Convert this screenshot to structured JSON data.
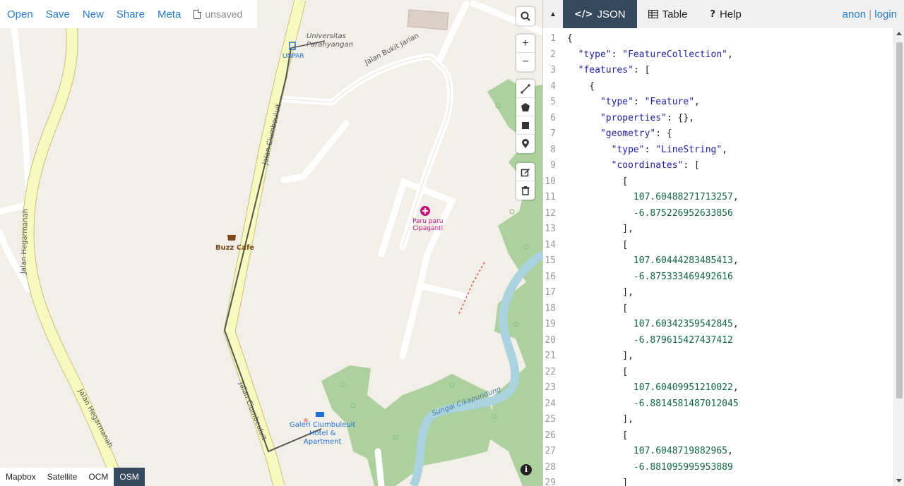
{
  "menu": {
    "items": [
      "Open",
      "Save",
      "New",
      "Share",
      "Meta"
    ],
    "status": "unsaved"
  },
  "map_labels": {
    "university": "Universitas\nParahyangan",
    "unpar": "UNPAR",
    "jalan_bukit_jarian": "Jalan Bukit Jarian",
    "jalan_ciumbeuluit_top": "Jalan Ciumbeuluit",
    "jalan_ciumbeuluit_bottom": "Jalan Ciumbeuluit",
    "jalan_hegarmanah_left": "Jalan Hegarmanah",
    "jalan_hegarmanah_bottom": "Jalan Hegarmanah",
    "buzz_cafe": "Buzz Cafe",
    "paru_paru": "Paru paru\nCipaganti",
    "galeri": "Galeri Ciumbuleuit\nHotel &\nApartment",
    "sungai": "Sungai Cikapundung"
  },
  "layers": {
    "items": [
      "Mapbox",
      "Satellite",
      "OCM",
      "OSM"
    ],
    "active": "OSM"
  },
  "tabs": {
    "items": [
      {
        "label": "JSON",
        "icon": "code-icon"
      },
      {
        "label": "Table",
        "icon": "table-icon"
      },
      {
        "label": "Help",
        "icon": "help-icon"
      }
    ],
    "active": "JSON"
  },
  "user": {
    "anon": "anon",
    "login": "login"
  },
  "editor": {
    "lines": [
      "{",
      "  \"type\": \"FeatureCollection\",",
      "  \"features\": [",
      "    {",
      "      \"type\": \"Feature\",",
      "      \"properties\": {},",
      "      \"geometry\": {",
      "        \"type\": \"LineString\",",
      "        \"coordinates\": [",
      "          [",
      "            107.60488271713257,",
      "            -6.875226952633856",
      "          ],",
      "          [",
      "            107.60444283485413,",
      "            -6.875333469492616",
      "          ],",
      "          [",
      "            107.60342359542845,",
      "            -6.879615427437412",
      "          ],",
      "          [",
      "            107.60409951210022,",
      "            -6.8814581487012045",
      "          ],",
      "          [",
      "            107.6048719882965,",
      "            -6.881095995953889",
      "          ]"
    ]
  }
}
